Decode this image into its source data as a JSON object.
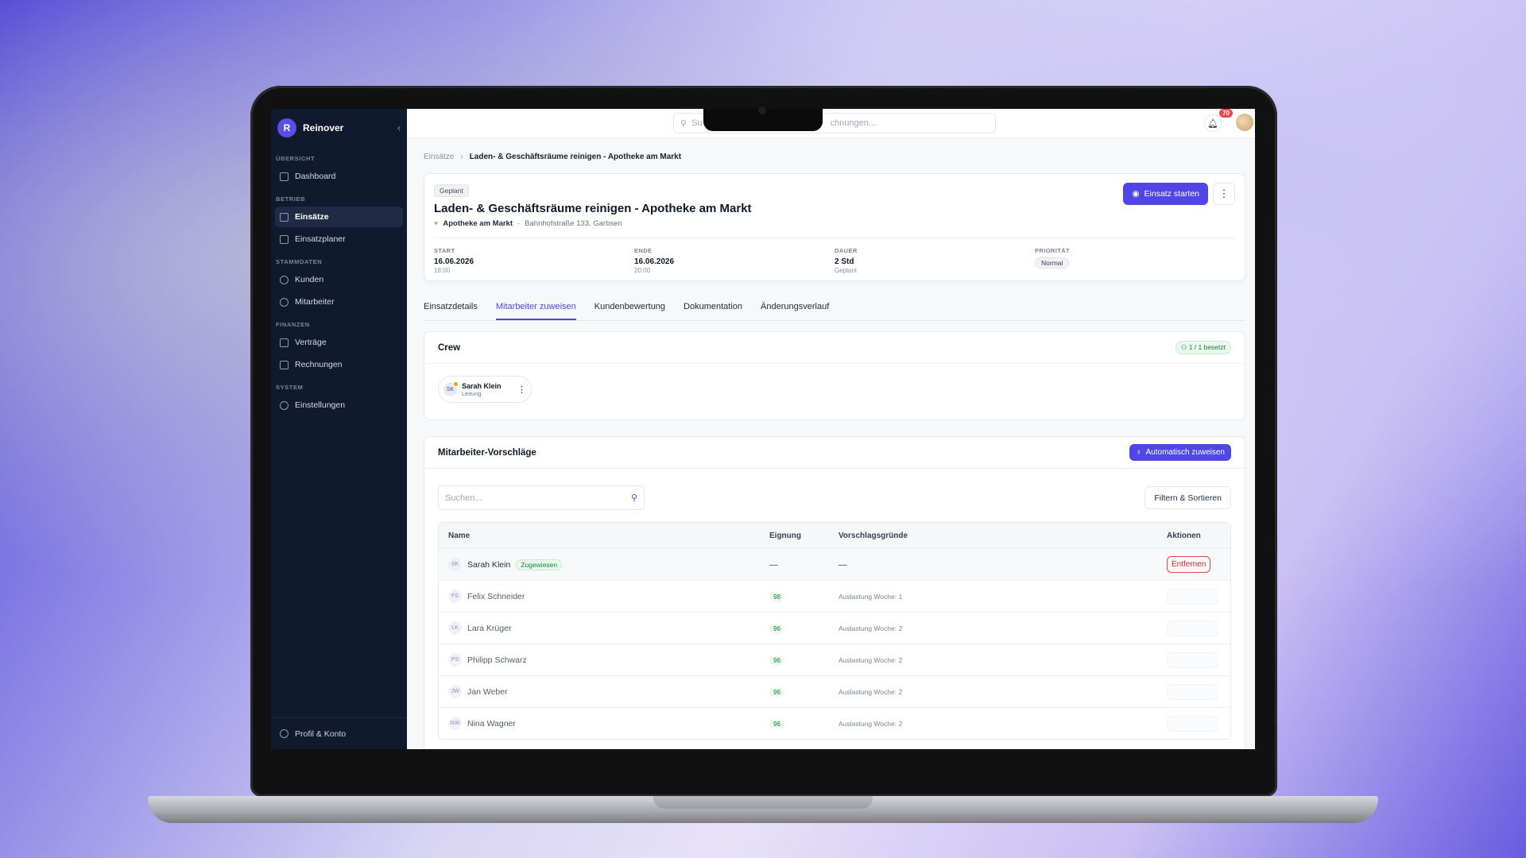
{
  "app": {
    "name": "Reinover",
    "logo_letter": "R",
    "collapse_icon": "chevron-left-icon"
  },
  "sidebar": {
    "sections": [
      {
        "label": "ÜBERSICHT",
        "items": [
          {
            "label": "Dashboard",
            "icon": "grid-icon"
          }
        ]
      },
      {
        "label": "BETRIEB",
        "items": [
          {
            "label": "Einsätze",
            "icon": "clipboard-icon",
            "active": true
          },
          {
            "label": "Einsatzplaner",
            "icon": "calendar-icon"
          }
        ]
      },
      {
        "label": "STAMMDATEN",
        "items": [
          {
            "label": "Kunden",
            "icon": "users-icon"
          },
          {
            "label": "Mitarbeiter",
            "icon": "user-cog-icon"
          }
        ]
      },
      {
        "label": "FINANZEN",
        "items": [
          {
            "label": "Verträge",
            "icon": "file-icon"
          },
          {
            "label": "Rechnungen",
            "icon": "receipt-icon"
          }
        ]
      },
      {
        "label": "SYSTEM",
        "items": [
          {
            "label": "Einstellungen",
            "icon": "gear-icon"
          }
        ]
      }
    ],
    "footer": {
      "label": "Profil & Konto",
      "icon": "user-circle-icon"
    }
  },
  "topbar": {
    "search_placeholder_left": "Su",
    "search_placeholder_right": "chnungen...",
    "notification_count": "70"
  },
  "breadcrumb": {
    "parent": "Einsätze",
    "current": "Laden- & Geschäftsräume reinigen - Apotheke am Markt"
  },
  "job": {
    "status": "Geplant",
    "title": "Laden- & Geschäftsräume reinigen - Apotheke am Markt",
    "location_name": "Apotheke am Markt",
    "address": "Bahnhofstraße 133, Garbsen",
    "start_button": "Einsatz starten",
    "meta": {
      "start_label": "START",
      "start_date": "16.06.2026",
      "start_time": "18:00",
      "end_label": "ENDE",
      "end_date": "16.06.2026",
      "end_time": "20:00",
      "duration_label": "DAUER",
      "duration": "2 Std",
      "duration_sub": "Geplant",
      "priority_label": "PRIORITÄT",
      "priority": "Normal"
    }
  },
  "tabs": [
    "Einsatzdetails",
    "Mitarbeiter zuweisen",
    "Kundenbewertung",
    "Dokumentation",
    "Änderungsverlauf"
  ],
  "active_tab": 1,
  "crew": {
    "title": "Crew",
    "occupancy": "1 / 1 besetzt",
    "member": {
      "initials": "SK",
      "name": "Sarah Klein",
      "role": "Leitung"
    }
  },
  "suggestions": {
    "title": "Mitarbeiter-Vorschläge",
    "auto_button": "Automatisch zuweisen",
    "search_placeholder": "Suchen...",
    "filter_button": "Filtern & Sortieren",
    "columns": [
      "Name",
      "Eignung",
      "Vorschlagsgründe",
      "Aktionen"
    ],
    "assigned_row": {
      "initials": "SK",
      "name": "Sarah Klein",
      "tag": "Zugewiesen",
      "fit": "—",
      "reason": "—",
      "action": "Entfernen"
    },
    "rows": [
      {
        "initials": "FS",
        "name": "Felix Schneider",
        "fit": "98",
        "reason": "Auslastung Woche: 1"
      },
      {
        "initials": "LK",
        "name": "Lara Krüger",
        "fit": "96",
        "reason": "Auslastung Woche: 2"
      },
      {
        "initials": "PS",
        "name": "Philipp Schwarz",
        "fit": "96",
        "reason": "Auslastung Woche: 2"
      },
      {
        "initials": "JW",
        "name": "Jan Weber",
        "fit": "96",
        "reason": "Auslastung Woche: 2"
      },
      {
        "initials": "NW",
        "name": "Nina Wagner",
        "fit": "96",
        "reason": "Auslastung Woche: 2"
      }
    ]
  },
  "colors": {
    "accent": "#4f46e5",
    "sidebar_bg": "#0f1a2e",
    "success": "#15803d",
    "danger": "#dc2626"
  }
}
